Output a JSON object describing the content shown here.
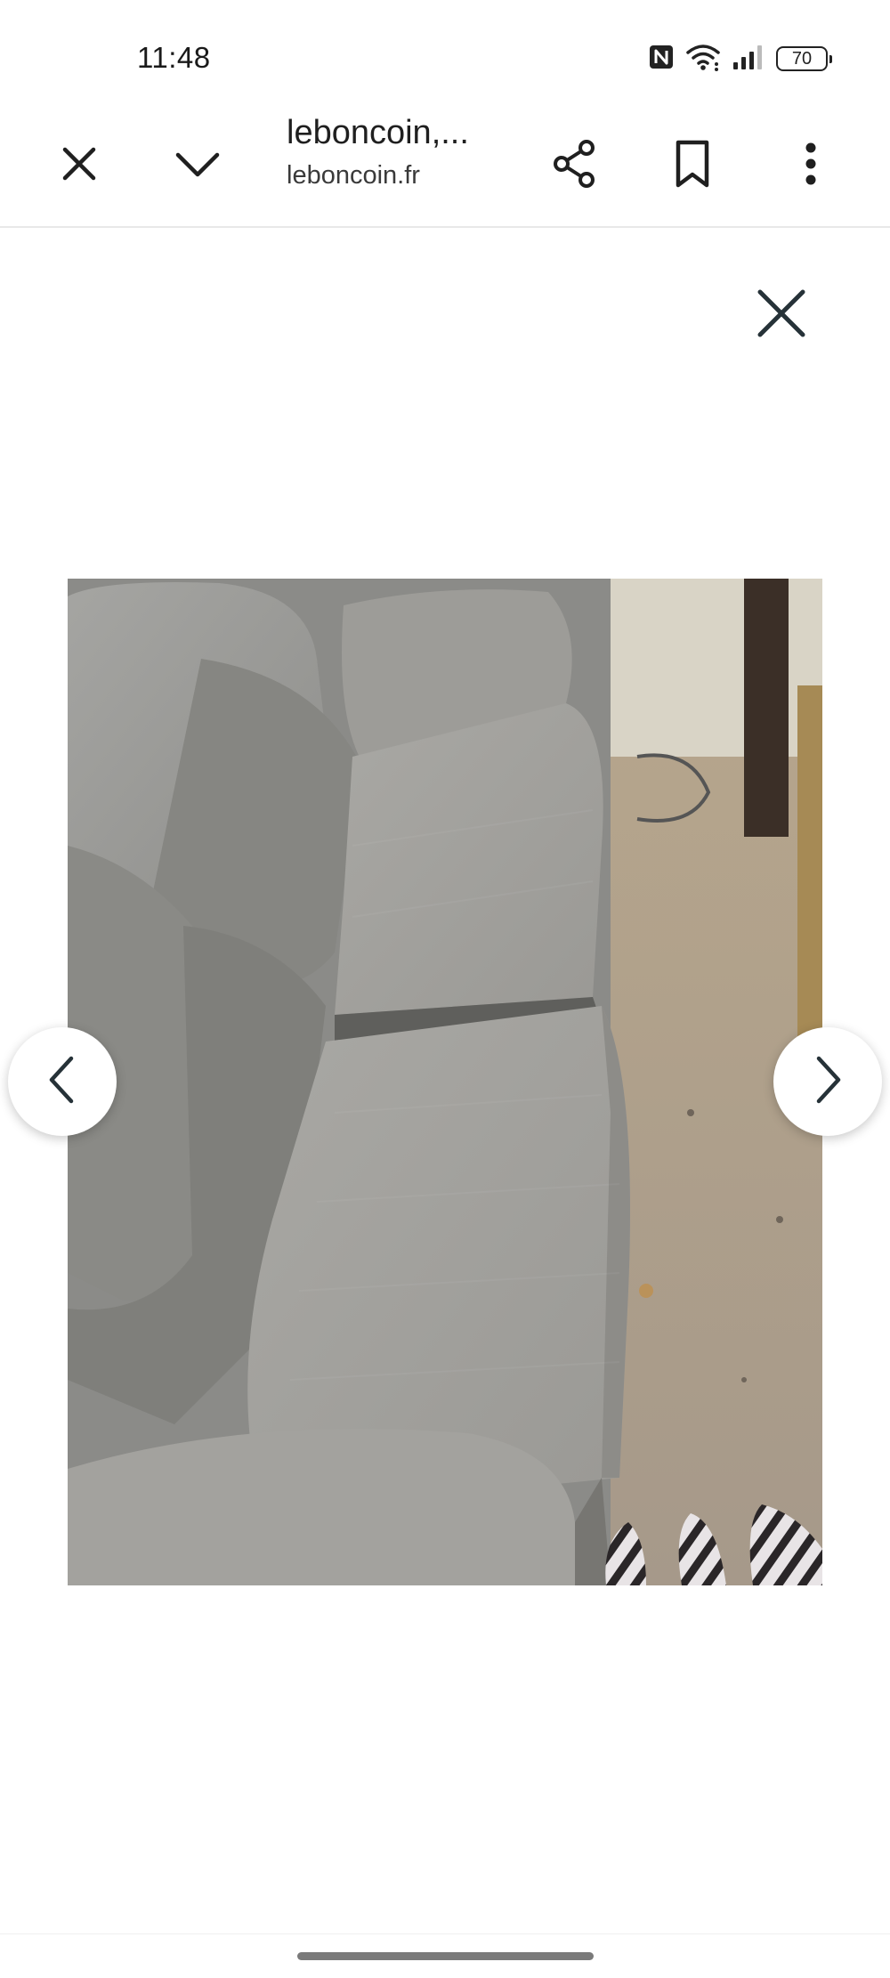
{
  "status_bar": {
    "time": "11:48",
    "battery_level": "70",
    "icons": [
      "nfc-icon",
      "wifi-icon",
      "signal-icon",
      "battery-icon"
    ]
  },
  "toolbar": {
    "title": "leboncoin,...",
    "url": "leboncoin.fr",
    "icons": [
      "close-icon",
      "chevron-down-icon",
      "share-icon",
      "bookmark-icon",
      "more-vert-icon"
    ]
  },
  "viewer": {
    "icons": [
      "close-icon",
      "chevron-left-icon",
      "chevron-right-icon"
    ]
  },
  "colors": {
    "icon": "#263238",
    "text": "#1f1f1f",
    "divider": "#e8e8e8",
    "gesture_bar": "#7a7a7a"
  }
}
